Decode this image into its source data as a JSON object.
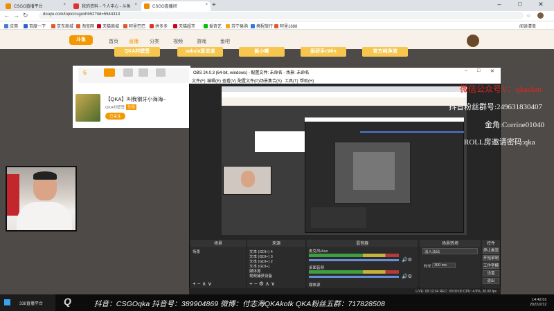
{
  "browser": {
    "tabs": [
      {
        "label": "CSGO直播平台"
      },
      {
        "label": "我的资料 - 个人中心 - 斗鱼"
      },
      {
        "label": "CSGO直播间"
      }
    ],
    "url": "douyu.com/topic/csgoxhb52?rid=5544313",
    "bookmarks": [
      "应用",
      "百度一下",
      "京东商城",
      "淘宝网",
      "天猫商城",
      "阿里巴巴",
      "拼多多",
      "天猫超市",
      "爱奇艺",
      "苏宁易购",
      "携程旅行",
      "阿里1688"
    ],
    "bookmarks_right": "阅读清单"
  },
  "site": {
    "nav": [
      "首页",
      "直播",
      "分类",
      "视频",
      "游戏",
      "鱼吧"
    ],
    "yellow_tabs": [
      "QKA村壁签",
      "sakula复说谈",
      "新小峰",
      "狙研手cWin",
      "官方纯净流"
    ],
    "stat_number": "6",
    "room_title": "【QKA】叫我钢牙小海海~",
    "room_meta": [
      "QKA村壁签",
      "头衔",
      "已关注"
    ]
  },
  "obs": {
    "title": "OBS 24.0.3 (64-bit, windows) - 配置文件: 未命名 - 场景: 未命名",
    "menu": [
      "文件(F)",
      "编辑(E)",
      "查看(V)",
      "配置文件(P)",
      "场景集合(S)",
      "工具(T)",
      "帮助(H)"
    ],
    "docks": {
      "scenes_title": "场景",
      "sources_title": "来源",
      "mixer_title": "混音器",
      "transitions_title": "场景转场",
      "controls_title": "控件"
    },
    "scene_item": "场景",
    "sources": [
      "文本 (GDI+) 4",
      "文本 (GDI+) 3",
      "文本 (GDI+) 2",
      "文本 (GDI+)",
      "媒体源",
      "视频捕获设备"
    ],
    "mixer_rows": [
      "麦克风/Aux",
      "桌面音频",
      "媒体源"
    ],
    "transition_value": "淡入淡出",
    "duration_label": "时长",
    "duration_value": "300 ms",
    "controls": [
      "停止推流",
      "开始录制",
      "工作室模式",
      "设置",
      "退出"
    ],
    "status": "LIVE: 00:12:34    REC: 00:00:00    CPU: 4.9%, 30.00 fps"
  },
  "overlay": {
    "vx": "微信公众号V：qkaskm",
    "fans": "抖音粉丝群号:249631830407",
    "gold": "金角:Corrine01040",
    "roll": "ROLL房邀请密码:qka"
  },
  "banner": "抖音：CSGOqka   抖音号：389904869   微博：付志海QKAkofk   QKA粉丝五群：717828508",
  "taskbar": {
    "item": "338直播平台",
    "time": "14:42:01",
    "date": "2022/2/12"
  },
  "colors": {
    "overlay_red": "#e0261f",
    "overlay_white": "#f5f5f5",
    "douyu_orange": "#f39800"
  }
}
